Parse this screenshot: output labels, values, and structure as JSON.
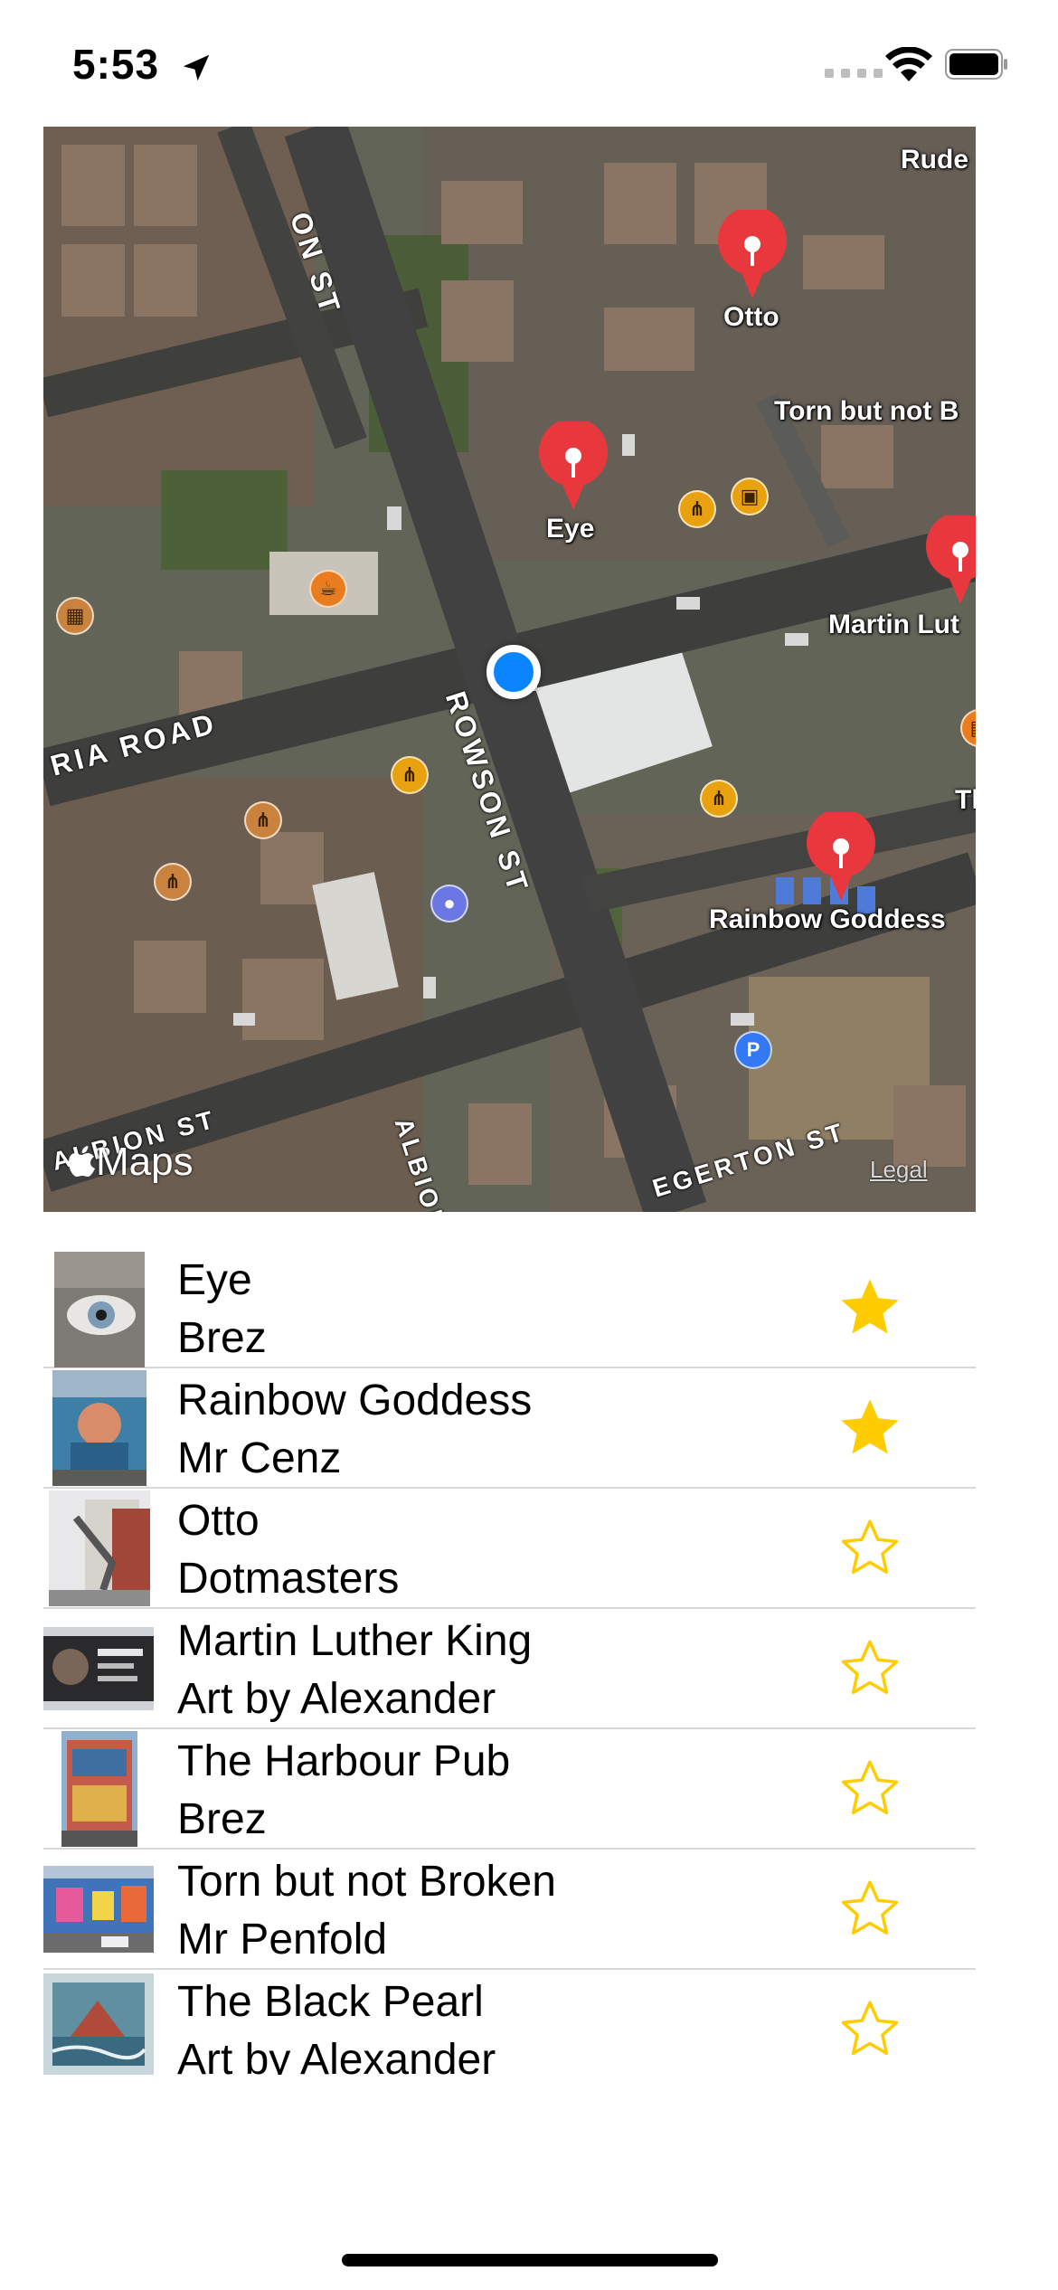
{
  "status_bar": {
    "time": "5:53"
  },
  "map": {
    "streets": [
      "ON ST",
      "ROWSON ST",
      "RIA ROAD",
      "ALBION ST",
      "ALBION",
      "EGERTON ST"
    ],
    "pins": [
      "Otto",
      "Eye",
      "Martin Lut",
      "Rainbow Goddess"
    ],
    "edge_labels": [
      "Rude",
      "Torn but not B",
      "Th"
    ],
    "maps_logo": "Maps",
    "legal": "Legal",
    "pin_color": "#e8383d",
    "user_location_color": "#0a84ff"
  },
  "artworks": [
    {
      "title": "Eye",
      "artist": "Brez",
      "favorite": true
    },
    {
      "title": "Rainbow Goddess",
      "artist": "Mr Cenz",
      "favorite": true
    },
    {
      "title": "Otto",
      "artist": "Dotmasters",
      "favorite": false
    },
    {
      "title": "Martin Luther King",
      "artist": "Art by Alexander",
      "favorite": false
    },
    {
      "title": "The Harbour Pub",
      "artist": "Brez",
      "favorite": false
    },
    {
      "title": "Torn but not Broken",
      "artist": "Mr Penfold",
      "favorite": false
    },
    {
      "title": "The Black Pearl",
      "artist": "Art by Alexander",
      "favorite": false
    }
  ],
  "colors": {
    "star": "#ffcc00",
    "separator": "#d8d8dc"
  }
}
